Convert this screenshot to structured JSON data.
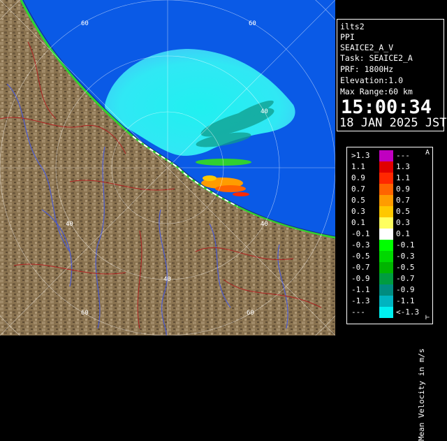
{
  "info": {
    "site": "ilts2",
    "scan": "PPI",
    "product": "SEAICE2_A_V",
    "task": "Task: SEAICE2_A",
    "prf": "PRF: 1800Hz",
    "elevation": "Elevation:1.0",
    "max_range": "Max Range:60 km",
    "time": "15:00:34",
    "date": "18 JAN 2025 JST"
  },
  "range_labels": [
    "60",
    "40",
    "40",
    "40",
    "40",
    "60",
    "60",
    "60"
  ],
  "legend": {
    "title": "Mean Velocity in m/s",
    "top_mark": "A",
    "bottom_mark": "⊢",
    "rows": [
      {
        "left": ">1.3",
        "right": "---",
        "color": "#c000c0"
      },
      {
        "left": "1.1",
        "right": "1.3",
        "color": "#e00000"
      },
      {
        "left": "0.9",
        "right": "1.1",
        "color": "#ff2800"
      },
      {
        "left": "0.7",
        "right": "0.9",
        "color": "#ff6400"
      },
      {
        "left": "0.5",
        "right": "0.7",
        "color": "#ff9c00"
      },
      {
        "left": "0.3",
        "right": "0.5",
        "color": "#ffc800"
      },
      {
        "left": "0.1",
        "right": "0.3",
        "color": "#ffff60"
      },
      {
        "left": "-0.1",
        "right": "0.1",
        "color": "#ffffff"
      },
      {
        "left": "-0.3",
        "right": "-0.1",
        "color": "#00ff00"
      },
      {
        "left": "-0.5",
        "right": "-0.3",
        "color": "#00d800"
      },
      {
        "left": "-0.7",
        "right": "-0.5",
        "color": "#00b400"
      },
      {
        "left": "-0.9",
        "right": "-0.7",
        "color": "#009c40"
      },
      {
        "left": "-1.1",
        "right": "-0.9",
        "color": "#008c80"
      },
      {
        "left": "-1.3",
        "right": "-1.1",
        "color": "#00b4c0"
      },
      {
        "left": "---",
        "right": "<-1.3",
        "color": "#00f0f0"
      }
    ]
  },
  "colors": {
    "sea": "#0a5ae6",
    "land": "#8a7350",
    "velocity_cyan": "#00f0f0"
  }
}
